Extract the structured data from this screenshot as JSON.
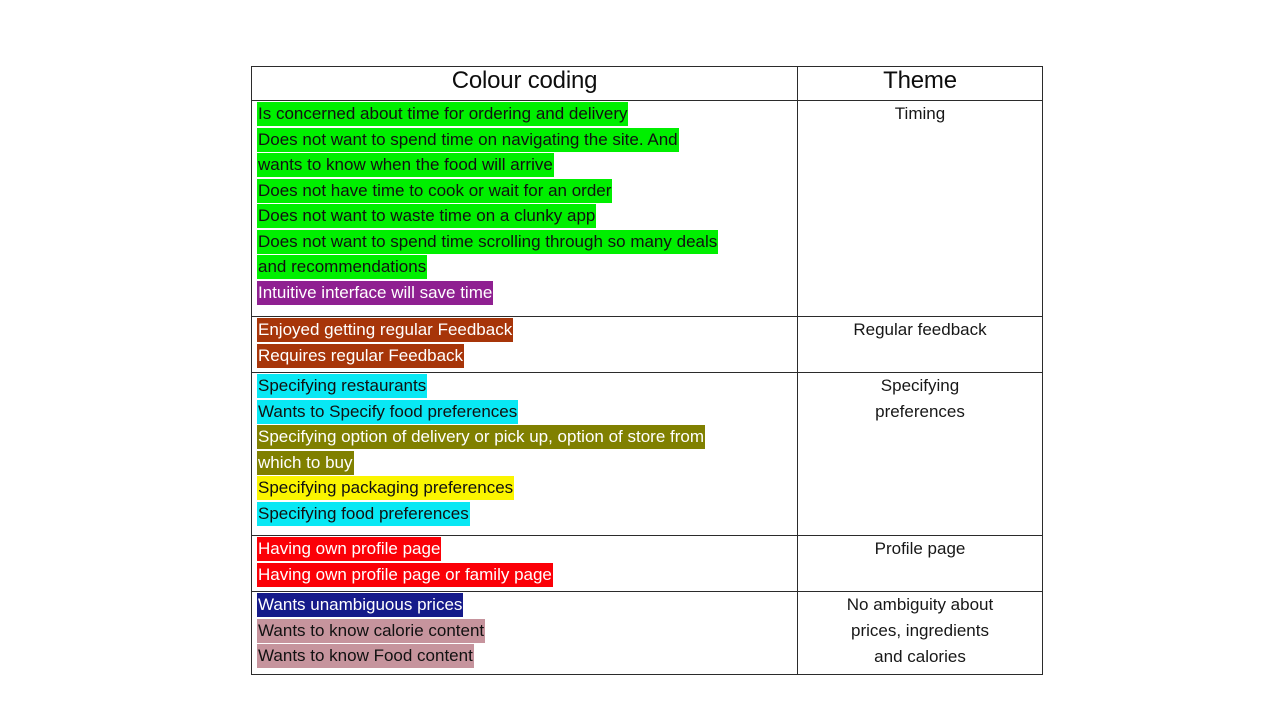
{
  "table": {
    "headers": {
      "coding": "Colour coding",
      "theme": "Theme"
    },
    "rows": [
      {
        "theme": "Timing",
        "theme_lines": [
          "Timing"
        ],
        "lines": [
          {
            "text": "Is concerned about time for ordering and delivery",
            "color": "green",
            "color_hex": "#00EF00"
          },
          {
            "text": "Does not want to spend time on navigating the site. And",
            "color": "green",
            "color_hex": "#00EF00"
          },
          {
            "text": "wants to know when the food will arrive",
            "color": "green",
            "color_hex": "#00EF00"
          },
          {
            "text": "Does not have time to cook or wait for an order",
            "color": "green",
            "color_hex": "#00EF00"
          },
          {
            "text": "Does not want to waste time on a clunky app",
            "color": "green",
            "color_hex": "#00EF00"
          },
          {
            "text": "Does not want to spend time scrolling through so many deals",
            "color": "green",
            "color_hex": "#00EF00"
          },
          {
            "text": "and recommendations",
            "color": "green",
            "color_hex": "#00EF00"
          },
          {
            "text": "Intuitive interface will save time",
            "color": "purple",
            "color_hex": "#8F2091"
          }
        ]
      },
      {
        "theme": "Regular feedback",
        "theme_lines": [
          "Regular feedback"
        ],
        "lines": [
          {
            "text": "Enjoyed getting regular Feedback",
            "color": "brown",
            "color_hex": "#A73509"
          },
          {
            "text": "Requires regular Feedback",
            "color": "brown",
            "color_hex": "#A73509"
          }
        ]
      },
      {
        "theme": "Specifying preferences",
        "theme_lines": [
          "Specifying",
          "preferences"
        ],
        "lines": [
          {
            "text": "Specifying restaurants",
            "color": "cyan",
            "color_hex": "#08E8F4"
          },
          {
            "text": "Wants to Specify food preferences",
            "color": "cyan",
            "color_hex": "#08E8F4"
          },
          {
            "text": "Specifying option of delivery or pick up, option of store from",
            "color": "olive",
            "color_hex": "#808000"
          },
          {
            "text": "which to buy",
            "color": "olive",
            "color_hex": "#808000"
          },
          {
            "text": "Specifying packaging preferences",
            "color": "yellow",
            "color_hex": "#FBF500"
          },
          {
            "text": "Specifying food preferences",
            "color": "cyan",
            "color_hex": "#08E8F4"
          }
        ]
      },
      {
        "theme": "Profile page",
        "theme_lines": [
          "Profile page"
        ],
        "lines": [
          {
            "text": "Having own profile page",
            "color": "red",
            "color_hex": "#FB0007"
          },
          {
            "text": "Having own profile page or family page",
            "color": "red",
            "color_hex": "#FB0007"
          }
        ]
      },
      {
        "theme": "No ambiguity about prices, ingredients and calories",
        "theme_lines": [
          "No ambiguity about",
          "prices, ingredients",
          "and calories"
        ],
        "lines": [
          {
            "text": "Wants unambiguous prices",
            "color": "navy",
            "color_hex": "#151A8A"
          },
          {
            "text": "Wants to know calorie content",
            "color": "rose",
            "color_hex": "#C6949D"
          },
          {
            "text": "Wants to know Food content",
            "color": "rose",
            "color_hex": "#C6949D"
          }
        ]
      }
    ]
  }
}
